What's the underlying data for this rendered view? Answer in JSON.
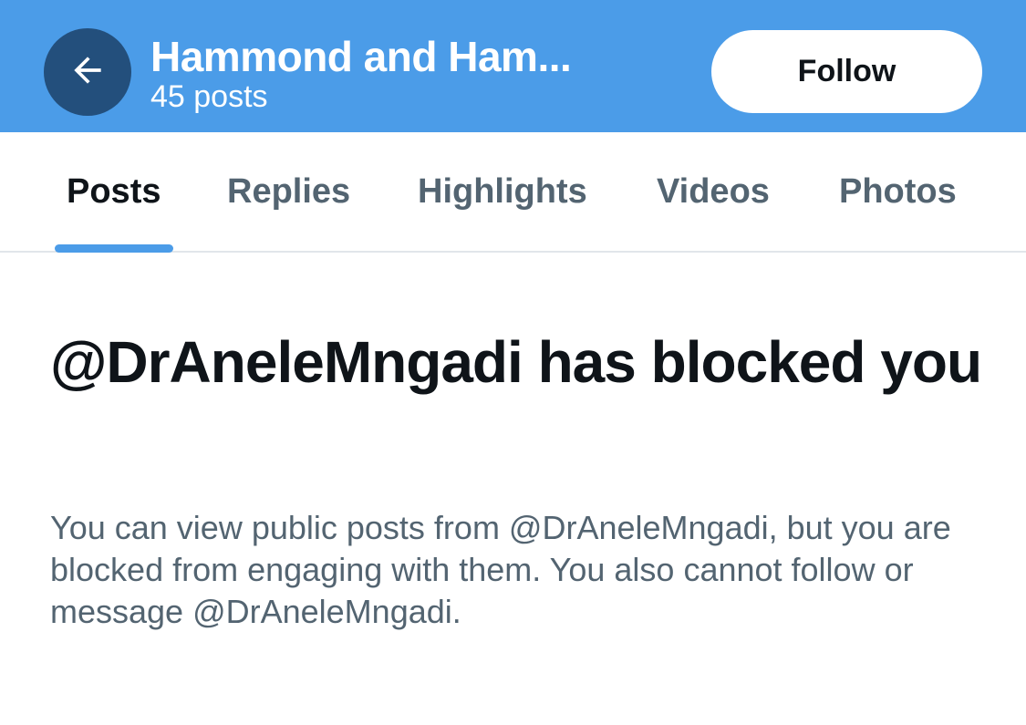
{
  "header": {
    "title": "Hammond and Ham...",
    "subtitle": "45 posts",
    "back_icon": "back-arrow-icon",
    "follow_label": "Follow",
    "background_color": "#4b9ce8"
  },
  "tabs": [
    {
      "label": "Posts",
      "active": true
    },
    {
      "label": "Replies",
      "active": false
    },
    {
      "label": "Highlights",
      "active": false
    },
    {
      "label": "Videos",
      "active": false
    },
    {
      "label": "Photos",
      "active": false
    }
  ],
  "blocked_notice": {
    "title": "@DrAneleMngadi has blocked you",
    "description": "You can view public posts from @DrAneleMngadi, but you are blocked from engaging with them. You also cannot follow or message @DrAneleMngadi."
  },
  "colors": {
    "accent": "#4b9ce8",
    "text_primary": "#0f1419",
    "text_secondary": "#536471"
  }
}
